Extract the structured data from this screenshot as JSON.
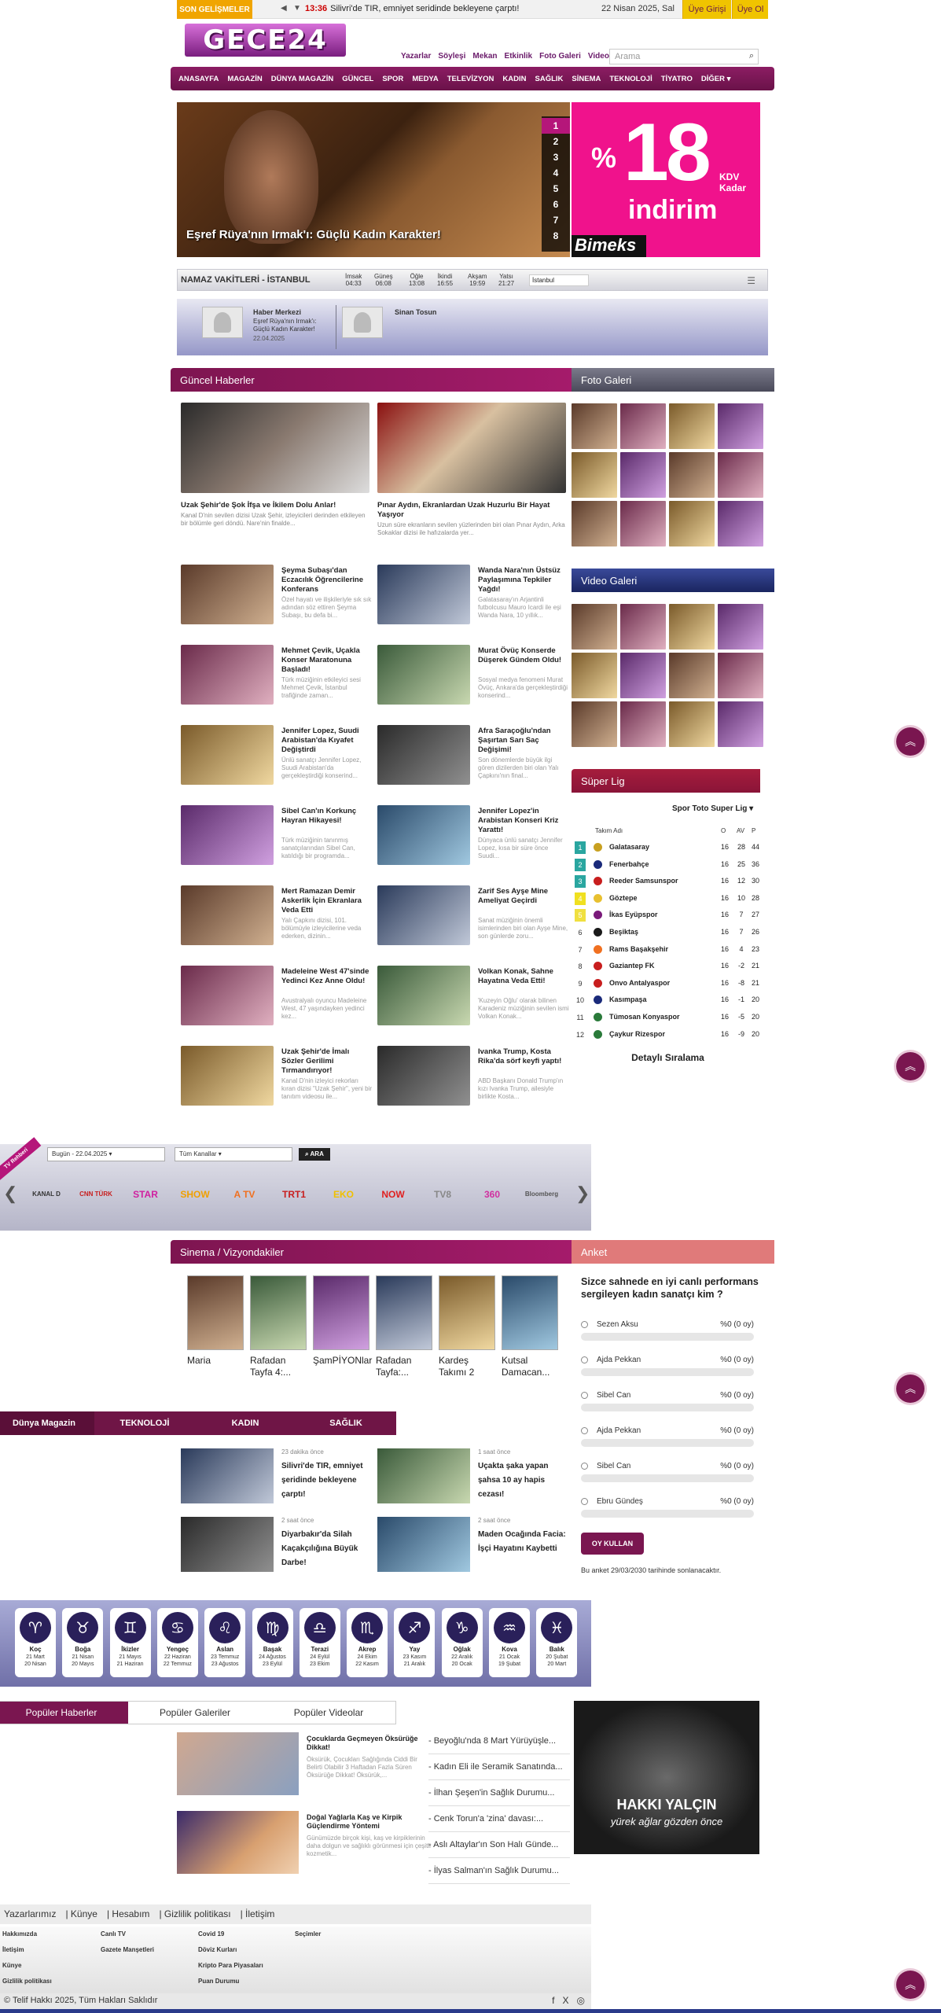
{
  "topbar": {
    "breaking_label": "SON GELİŞMELER",
    "ticker_time": "13:36",
    "ticker_text": "Silivri'de TIR, emniyet seridinde bekleyene çarptı!",
    "date": "22 Nisan 2025, Sal",
    "login": "Üye Girişi",
    "signup": "Üye Ol"
  },
  "logo": "GECE24",
  "toplinks": [
    "Yazarlar",
    "Söyleşi",
    "Mekan",
    "Etkinlik",
    "Foto Galeri",
    "Video"
  ],
  "search": {
    "placeholder": "Arama"
  },
  "nav": [
    "ANASAYFA",
    "MAGAZİN",
    "DÜNYA MAGAZİN",
    "GÜNCEL",
    "SPOR",
    "MEDYA",
    "TELEVİZYON",
    "KADIN",
    "SAĞLIK",
    "SİNEMA",
    "TEKNOLOJİ",
    "TİYATRO",
    "DİĞER ▾"
  ],
  "slider": {
    "caption": "Eşref Rüya'nın Irmak'ı: Güçlü Kadın Karakter!",
    "numbers": [
      "1",
      "2",
      "3",
      "4",
      "5",
      "6",
      "7",
      "8"
    ]
  },
  "ad": {
    "percent": "%",
    "number": "18",
    "kdv1": "KDV",
    "kdv2": "Kadar",
    "indirim": "indirim",
    "brand": "Bimeks"
  },
  "namaz": {
    "title": "NAMAZ VAKİTLERİ - İSTANBUL",
    "times": [
      {
        "n": "İmsak",
        "v": "04:33"
      },
      {
        "n": "Güneş",
        "v": "06:08"
      },
      {
        "n": "Öğle",
        "v": "13:08"
      },
      {
        "n": "İkindi",
        "v": "16:55"
      },
      {
        "n": "Akşam",
        "v": "19:59"
      },
      {
        "n": "Yatsı",
        "v": "21:27"
      }
    ],
    "city": "İstanbul"
  },
  "writers": [
    {
      "name": "Haber Merkezi",
      "sub": "Eşref Rüya'nın Irmak'ı: Güçlü Kadın Karakter!",
      "date": "22.04.2025"
    },
    {
      "name": "Sinan Tosun"
    }
  ],
  "guncel": {
    "title": "Güncel Haberler",
    "top": [
      {
        "t": "Uzak Şehir'de Şok İfşa ve İkilem Dolu Anlar!",
        "s": "Kanal D'nin sevilen dizisi Uzak Şehir, izleyicileri derinden etkileyen bir bölümle geri döndü. Nare'nin finalde..."
      },
      {
        "t": "Pınar Aydın, Ekranlardan Uzak Huzurlu Bir Hayat Yaşıyor",
        "s": "Uzun süre ekranların sevilen yüzlerinden biri olan Pınar Aydın, Arka Sokaklar dizisi ile hafızalarda yer..."
      }
    ],
    "list": [
      {
        "t": "Şeyma Subaşı'dan Eczacılık Öğrencilerine Konferans",
        "s": "Özel hayatı ve ilişkileriyle sık sık adından söz ettiren Şeyma Subaşı, bu defa bi..."
      },
      {
        "t": "Wanda Nara'nın Üstsüz Paylaşımına Tepkiler Yağdı!",
        "s": "Galatasaray'ın Arjantinli futbolcusu Mauro Icardi ile eşi Wanda Nara, 10 yıllık..."
      },
      {
        "t": "Mehmet Çevik, Uçakla Konser Maratonuna Başladı!",
        "s": "Türk müziğinin etkileyici sesi Mehmet Çevik, İstanbul trafiğinde zaman..."
      },
      {
        "t": "Murat Övüç Konserde Düşerek Gündem Oldu!",
        "s": "Sosyal medya fenomeni Murat Övüç, Ankara'da gerçekleştirdiği konserind..."
      },
      {
        "t": "Jennifer Lopez, Suudi Arabistan'da Kıyafet Değiştirdi",
        "s": "Ünlü sanatçı Jennifer Lopez, Suudi Arabistan'da gerçekleştirdiği konserind..."
      },
      {
        "t": "Afra Saraçoğlu'ndan Şaşırtan Sarı Saç Değişimi!",
        "s": "Son dönemlerde büyük ilgi gören dizilerden biri olan Yalı Çapkını'nın final..."
      },
      {
        "t": "Sibel Can'ın Korkunç Hayran Hikayesi!",
        "s": "Türk müziğinin tanınmış sanatçılarından Sibel Can, katıldığı bir programda..."
      },
      {
        "t": "Jennifer Lopez'in Arabistan Konseri Kriz Yarattı!",
        "s": "Dünyaca ünlü sanatçı Jennifer Lopez, kısa bir süre önce Suudi..."
      },
      {
        "t": "Mert Ramazan Demir Askerlik İçin Ekranlara Veda Etti",
        "s": "Yalı Çapkını dizisi, 101. bölümüyle izleyicilerine veda ederken, dizinin..."
      },
      {
        "t": "Zarif Ses Ayşe Mine Ameliyat Geçirdi",
        "s": "Sanat müziğinin önemli isimlerinden biri olan Ayşe Mine, son günlerde zoru..."
      },
      {
        "t": "Madeleine West 47'sinde Yedinci Kez Anne Oldu!",
        "s": "Avustralyalı oyuncu Madeleine West, 47 yaşındayken yedinci kez..."
      },
      {
        "t": "Volkan Konak, Sahne Hayatına Veda Etti!",
        "s": "'Kuzeyin Oğlu' olarak bilinen Karadeniz müziğinin sevilen ismi Volkan Konak..."
      },
      {
        "t": "Uzak Şehir'de İmalı Sözler Gerilimi Tırmandırıyor!",
        "s": "Kanal D'nin izleyici rekorları kıran dizisi \"Uzak Şehir\", yeni bir tanıtım videosu ile..."
      },
      {
        "t": "Ivanka Trump, Kosta Rika'da sörf keyfi yaptı!",
        "s": "ABD Başkanı Donald Trump'ın kızı Ivanka Trump, ailesiyle birlikte Kosta..."
      }
    ]
  },
  "foto_galeri": {
    "title": "Foto Galeri"
  },
  "video_galeri": {
    "title": "Video Galeri"
  },
  "super_lig": {
    "title": "Süper Lig",
    "subtitle": "Spor Toto Super Lig ▾",
    "headers": {
      "team": "Takım Adı",
      "o": "O",
      "av": "AV",
      "p": "P"
    },
    "rows": [
      {
        "pos": "1",
        "team": "Galatasaray",
        "o": "16",
        "av": "28",
        "p": "44"
      },
      {
        "pos": "2",
        "team": "Fenerbahçe",
        "o": "16",
        "av": "25",
        "p": "36"
      },
      {
        "pos": "3",
        "team": "Reeder Samsunspor",
        "o": "16",
        "av": "12",
        "p": "30"
      },
      {
        "pos": "4",
        "team": "Göztepe",
        "o": "16",
        "av": "10",
        "p": "28"
      },
      {
        "pos": "5",
        "team": "İkas Eyüpspor",
        "o": "16",
        "av": "7",
        "p": "27"
      },
      {
        "pos": "6",
        "team": "Beşiktaş",
        "o": "16",
        "av": "7",
        "p": "26"
      },
      {
        "pos": "7",
        "team": "Rams Başakşehir",
        "o": "16",
        "av": "4",
        "p": "23"
      },
      {
        "pos": "8",
        "team": "Gaziantep FK",
        "o": "16",
        "av": "-2",
        "p": "21"
      },
      {
        "pos": "9",
        "team": "Onvo Antalyaspor",
        "o": "16",
        "av": "-8",
        "p": "21"
      },
      {
        "pos": "10",
        "team": "Kasımpaşa",
        "o": "16",
        "av": "-1",
        "p": "20"
      },
      {
        "pos": "11",
        "team": "Tümosan Konyaspor",
        "o": "16",
        "av": "-5",
        "p": "20"
      },
      {
        "pos": "12",
        "team": "Çaykur Rizespor",
        "o": "16",
        "av": "-9",
        "p": "20"
      }
    ],
    "detail": "Detaylı Sıralama"
  },
  "tv": {
    "ribbon": "TV Rehberi",
    "date_select": "Bugün - 22.04.2025 ▾",
    "channel_select": "Tüm Kanallar ▾",
    "button": "ARA",
    "channels": [
      "KANAL D",
      "CNN TÜRK",
      "STAR",
      "SHOW",
      "A TV",
      "TRT1",
      "EKO",
      "NOW",
      "TV8",
      "360",
      "Bloomberg"
    ]
  },
  "sinema": {
    "title": "Sinema / Vizyondakiler",
    "movies": [
      "Maria",
      "Rafadan Tayfa 4:...",
      "ŞamPİYONlar",
      "Rafadan Tayfa:...",
      "Kardeş Takımı 2",
      "Kutsal Damacan..."
    ]
  },
  "anket": {
    "title": "Anket",
    "question": "Sizce sahnede en iyi canlı performans sergileyen kadın sanatçı kim ?",
    "options": [
      {
        "n": "Sezen Aksu",
        "v": "%0 (0 oy)"
      },
      {
        "n": "Ajda Pekkan",
        "v": "%0 (0 oy)"
      },
      {
        "n": "Sibel Can",
        "v": "%0 (0 oy)"
      },
      {
        "n": "Ajda Pekkan",
        "v": "%0 (0 oy)"
      },
      {
        "n": "Sibel Can",
        "v": "%0 (0 oy)"
      },
      {
        "n": "Ebru Gündeş",
        "v": "%0 (0 oy)"
      }
    ],
    "button": "OY KULLAN",
    "note": "Bu anket 29/03/2030 tarihinde sonlanacaktır."
  },
  "tabs4": [
    "Dünya Magazin",
    "TEKNOLOJİ",
    "KADIN",
    "SAĞLIK"
  ],
  "dm": [
    {
      "tm": "23 dakika önce",
      "t": "Silivri'de TIR, emniyet şeridinde bekleyene çarptı!"
    },
    {
      "tm": "1 saat önce",
      "t": "Uçakta şaka yapan şahsa 10 ay hapis cezası!"
    },
    {
      "tm": "2 saat önce",
      "t": "Diyarbakır'da Silah Kaçakçılığına Büyük Darbe!"
    },
    {
      "tm": "2 saat önce",
      "t": "Maden Ocağında Facia: İşçi Hayatını Kaybetti"
    }
  ],
  "burc": [
    {
      "s": "♈",
      "n": "Koç",
      "d1": "21 Mart",
      "d2": "20 Nisan"
    },
    {
      "s": "♉",
      "n": "Boğa",
      "d1": "21 Nisan",
      "d2": "20 Mayıs"
    },
    {
      "s": "♊",
      "n": "İkizler",
      "d1": "21 Mayıs",
      "d2": "21 Haziran"
    },
    {
      "s": "♋",
      "n": "Yengeç",
      "d1": "22 Haziran",
      "d2": "22 Temmuz"
    },
    {
      "s": "♌",
      "n": "Aslan",
      "d1": "23 Temmuz",
      "d2": "23 Ağustos"
    },
    {
      "s": "♍",
      "n": "Başak",
      "d1": "24 Ağustos",
      "d2": "23 Eylül"
    },
    {
      "s": "♎",
      "n": "Terazi",
      "d1": "24 Eylül",
      "d2": "23 Ekim"
    },
    {
      "s": "♏",
      "n": "Akrep",
      "d1": "24 Ekim",
      "d2": "22 Kasım"
    },
    {
      "s": "♐",
      "n": "Yay",
      "d1": "23 Kasım",
      "d2": "21 Aralık"
    },
    {
      "s": "♑",
      "n": "Oğlak",
      "d1": "22 Aralık",
      "d2": "20 Ocak"
    },
    {
      "s": "♒",
      "n": "Kova",
      "d1": "21 Ocak",
      "d2": "19 Şubat"
    },
    {
      "s": "♓",
      "n": "Balık",
      "d1": "20 Şubat",
      "d2": "20 Mart"
    }
  ],
  "ptabs": [
    "Popüler Haberler",
    "Popüler Galeriler",
    "Popüler Videolar"
  ],
  "pop": [
    {
      "t": "Çocuklarda Geçmeyen Öksürüğe Dikkat!",
      "s": "Öksürük, Çocukları Sağlığında Ciddi Bir Belirti Olabilir 3 Haftadan Fazla Süren Öksürüğe Dikkat! Öksürük,..."
    },
    {
      "t": "Doğal Yağlarla Kaş ve Kirpik Güçlendirme Yöntemi",
      "s": "Günümüzde birçok kişi, kaş ve kirpiklerinin daha dolgun ve sağlıklı görünmesi için çeşitli kozmetik..."
    }
  ],
  "plist": [
    "- Beyoğlu'nda 8 Mart Yürüyüşle...",
    "- Kadın Eli ile Seramik Sanatında...",
    "- İlhan Şeşen'in Sağlık Durumu...",
    "- Cenk Torun'a 'zina' davası:...",
    "- Aslı Altaylar'ın Son Halı Günde...",
    "- İlyas Salman'ın Sağlık Durumu..."
  ],
  "hakki": {
    "t1": "HAKKI YALÇIN",
    "t2": "yürek ağlar gözden önce"
  },
  "foot_links": [
    "Yazarlarımız",
    "Künye",
    "Hesabım",
    "Gizlilik politikası",
    "İletişim"
  ],
  "foot_cols": [
    [
      "Hakkımızda",
      "İletişim",
      "Künye",
      "Gizlilik politikası"
    ],
    [
      "Canlı TV",
      "Gazete Manşetleri"
    ],
    [
      "Covid 19",
      "Döviz Kurları",
      "Kripto Para Piyasaları",
      "Puan Durumu"
    ],
    [
      "Seçimler"
    ]
  ],
  "copyright": "© Telif Hakkı 2025, Tüm Hakları Saklıdır",
  "social": [
    "f",
    "X",
    "◎"
  ]
}
